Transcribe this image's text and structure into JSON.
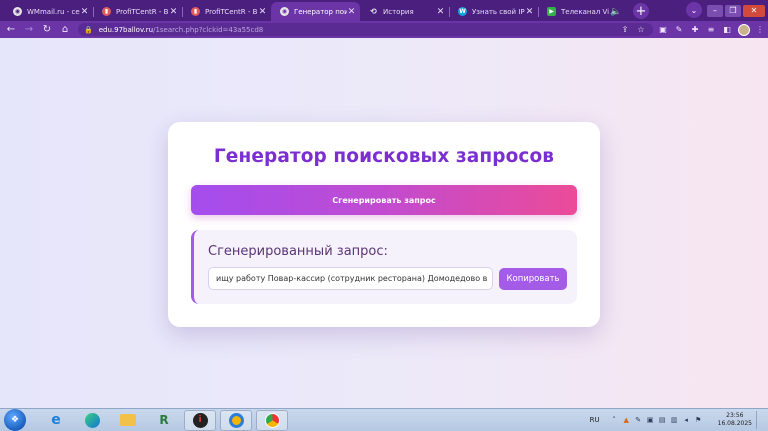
{
  "browser": {
    "tabs": [
      {
        "title": "WMmail.ru - серв",
        "favicon": "chromium-icon",
        "favicon_color": "#e6e6e6",
        "active": false
      },
      {
        "title": "ProfiTCentR - Вып",
        "favicon": "bar-chart-icon",
        "favicon_color": "#e05c5c",
        "active": false
      },
      {
        "title": "ProfiTCentR - Вып",
        "favicon": "bar-chart-icon",
        "favicon_color": "#e05c5c",
        "active": false
      },
      {
        "title": "Генератор поиско",
        "favicon": "chromium-icon",
        "favicon_color": "#e6e6e6",
        "active": true
      },
      {
        "title": "История",
        "favicon": "history-icon",
        "favicon_color": "#e6e6e6",
        "active": false
      },
      {
        "title": "Узнать свой IP ад",
        "favicon": "w-logo-icon",
        "favicon_color": "#1aa0d8",
        "active": false
      },
      {
        "title": "Телеканал Via",
        "favicon": "play-icon",
        "favicon_color": "#33b24a",
        "active": false
      }
    ],
    "url_host": "edu.97ballov.ru",
    "url_path": "/1search.php?clckid=43a55cd8"
  },
  "page": {
    "title": "Генератор поисковых запросов",
    "generate_button": "Сгенерировать запрос",
    "result_title": "Сгенерированный запрос:",
    "query_value": "ищу работу Повар-кассир (сотрудник ресторана) Домодедово в",
    "copy_button": "Копировать"
  },
  "taskbar": {
    "language": "RU",
    "time": "23:56",
    "date": "16.08.2025",
    "apps": [
      "internet-explorer-icon",
      "edge-icon",
      "file-explorer-icon",
      "app-r-icon",
      "app-i-icon",
      "app-circle-icon",
      "chrome-icon"
    ]
  },
  "colors": {
    "accent": "#7b2fd0",
    "button_gradient_start": "#a44dee",
    "button_gradient_end": "#ec4b98",
    "copy_button": "#a45ce8",
    "browser_frame": "#4a1f7e"
  }
}
